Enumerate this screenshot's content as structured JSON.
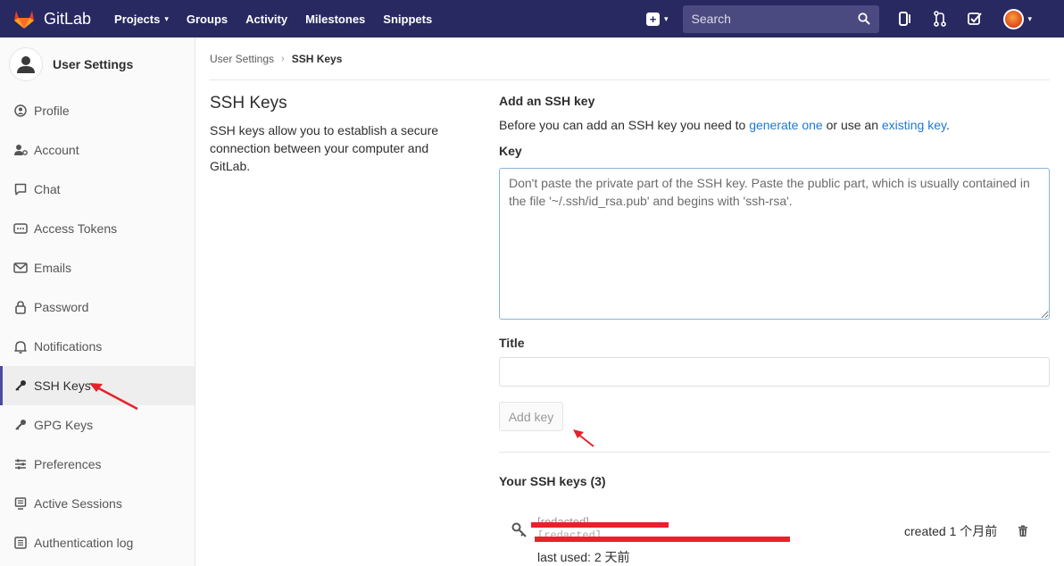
{
  "nav": {
    "brand": "GitLab",
    "links": [
      "Projects",
      "Groups",
      "Activity",
      "Milestones",
      "Snippets"
    ],
    "search_placeholder": "Search"
  },
  "sidebar": {
    "title": "User Settings",
    "items": [
      {
        "label": "Profile",
        "icon": "profile-icon"
      },
      {
        "label": "Account",
        "icon": "account-icon"
      },
      {
        "label": "Chat",
        "icon": "chat-icon"
      },
      {
        "label": "Access Tokens",
        "icon": "access-tokens-icon"
      },
      {
        "label": "Emails",
        "icon": "envelope-icon"
      },
      {
        "label": "Password",
        "icon": "lock-icon"
      },
      {
        "label": "Notifications",
        "icon": "bell-icon"
      },
      {
        "label": "SSH Keys",
        "icon": "key-icon",
        "active": true
      },
      {
        "label": "GPG Keys",
        "icon": "key-icon"
      },
      {
        "label": "Preferences",
        "icon": "sliders-icon"
      },
      {
        "label": "Active Sessions",
        "icon": "monitor-icon"
      },
      {
        "label": "Authentication log",
        "icon": "list-icon"
      }
    ]
  },
  "breadcrumb": {
    "parent": "User Settings",
    "current": "SSH Keys"
  },
  "intro": {
    "title": "SSH Keys",
    "description": "SSH keys allow you to establish a secure connection between your computer and GitLab."
  },
  "form": {
    "section_title": "Add an SSH key",
    "intro_prefix": "Before you can add an SSH key you need to ",
    "link_generate": "generate one",
    "intro_middle": " or use an ",
    "link_existing": "existing key",
    "intro_suffix": ".",
    "key_label": "Key",
    "key_placeholder": "Don't paste the private part of the SSH key. Paste the public part, which is usually contained in the file '~/.ssh/id_rsa.pub' and begins with 'ssh-rsa'.",
    "title_label": "Title",
    "add_button": "Add key"
  },
  "keys": {
    "heading": "Your SSH keys (3)",
    "items": [
      {
        "name": "[redacted]",
        "fingerprint": "[redacted]",
        "created": "created 1 个月前",
        "last_used": "last used: 2 天前"
      }
    ]
  },
  "colors": {
    "navbar": "#292961",
    "link": "#1f78d1",
    "annotation": "#e8212c",
    "active_bar": "#4b4ba3"
  }
}
